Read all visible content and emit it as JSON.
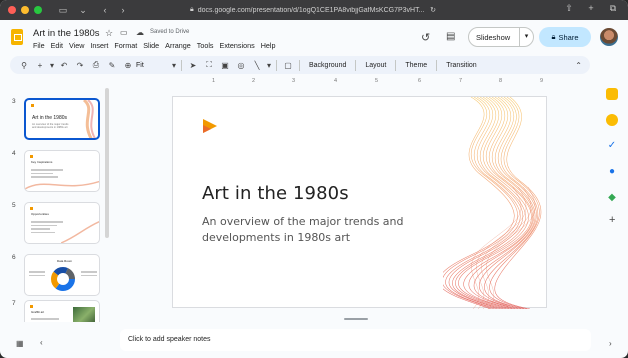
{
  "browser": {
    "url": "docs.google.com/presentation/d/1ogQ1CE1PA8vibjjGafMsKCG7P3vHT..."
  },
  "document": {
    "title": "Art in the 1980s",
    "save_status": "Saved to Drive"
  },
  "menu": [
    "File",
    "Edit",
    "View",
    "Insert",
    "Format",
    "Slide",
    "Arrange",
    "Tools",
    "Extensions",
    "Help"
  ],
  "header_buttons": {
    "slideshow": "Slideshow",
    "share": "Share"
  },
  "toolbar": {
    "zoom": "Fit",
    "background": "Background",
    "layout": "Layout",
    "theme": "Theme",
    "transition": "Transition"
  },
  "ruler_ticks": [
    "1",
    "2",
    "3",
    "4",
    "5",
    "6",
    "7",
    "8",
    "9"
  ],
  "filmstrip": [
    {
      "num": "3",
      "title": "Art in the 1980s",
      "subtitle": "An overview of the major trends and developments in 1980s art",
      "selected": true
    },
    {
      "num": "4",
      "title": "Key Inspirations"
    },
    {
      "num": "5",
      "title": "Opportunities"
    },
    {
      "num": "6",
      "title": "Data Room"
    },
    {
      "num": "7",
      "title": "Graffiti art"
    }
  ],
  "slide": {
    "title": "Art in the 1980s",
    "subtitle": "An overview of the major trends and developments in 1980s art"
  },
  "notes_placeholder": "Click to add speaker notes",
  "colors": {
    "accent_blue": "#0b57d0",
    "share_bg": "#c2e7ff",
    "logo_orange": "#f29900"
  }
}
